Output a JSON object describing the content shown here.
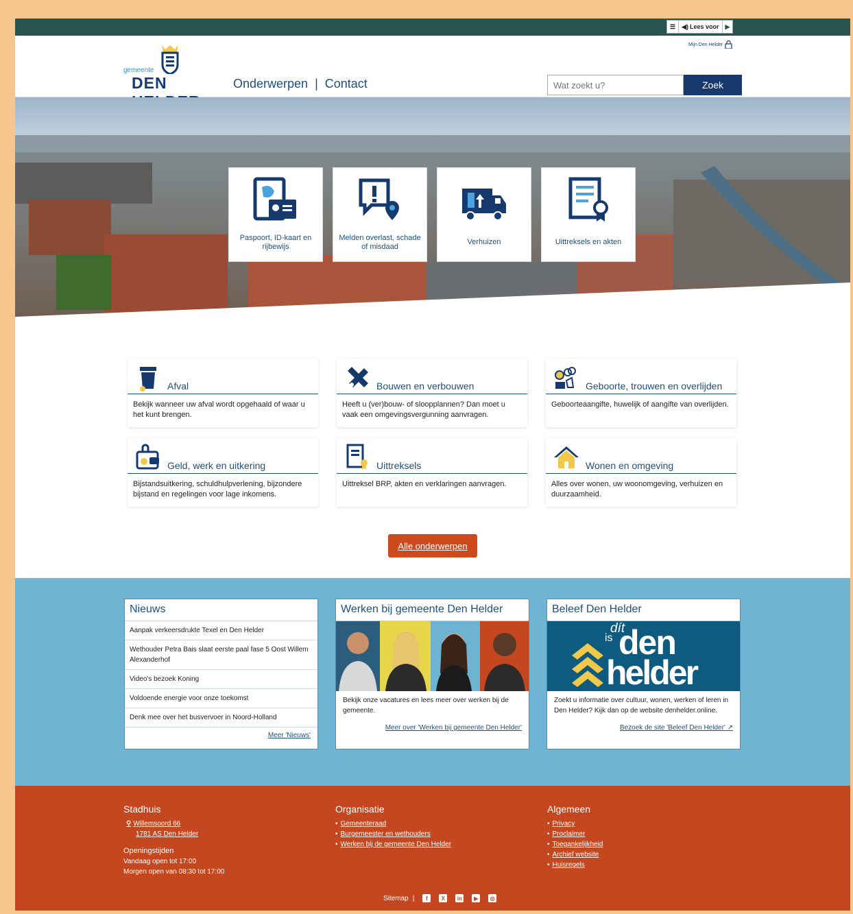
{
  "topbar": {
    "read_label": "Lees voor"
  },
  "header": {
    "mijn_label": "Mijn Den Helder",
    "logo_small": "gemeente",
    "logo_big": "DEN HELDER",
    "nav": [
      "Onderwerpen",
      "|",
      "Contact"
    ],
    "search_placeholder": "Wat zoekt u?",
    "search_button": "Zoek"
  },
  "hero": {
    "tiles": [
      {
        "label": "Paspoort, ID-kaart en rijbewijs",
        "icon": "id-card-icon"
      },
      {
        "label": "Melden overlast, schade of misdaad",
        "icon": "report-location-icon"
      },
      {
        "label": "Verhuizen",
        "icon": "moving-truck-icon"
      },
      {
        "label": "Uittreksels en akten",
        "icon": "certificate-icon"
      }
    ]
  },
  "topics": [
    {
      "title": "Afval",
      "text": "Bekijk wanneer uw afval wordt opgehaald of waar u het kunt brengen.",
      "icon": "bin-icon"
    },
    {
      "title": "Bouwen en verbouwen",
      "text": "Heeft u (ver)bouw- of sloopplannen? Dan moet u vaak een omgevingsvergunning aanvragen.",
      "icon": "tools-icon"
    },
    {
      "title": "Geboorte, trouwen en overlijden",
      "text": "Geboorteaangifte, huwelijk of aangifte van overlijden.",
      "icon": "family-icon"
    },
    {
      "title": "Geld, werk en uitkering",
      "text": "Bijstandsuitkering, schuldhulpverlening, bijzondere bijstand en regelingen voor lage inkomens.",
      "icon": "wallet-icon"
    },
    {
      "title": "Uittreksels",
      "text": "Uittreksel BRP, akten en verklaringen aanvragen.",
      "icon": "document-icon"
    },
    {
      "title": "Wonen en omgeving",
      "text": "Alles over wonen, uw woonomgeving, verhuizen en duurzaamheid.",
      "icon": "house-icon"
    }
  ],
  "alle_button": "Alle onderwerpen",
  "news": {
    "title": "Nieuws",
    "items": [
      "Aanpak verkeersdrukte Texel en Den Helder",
      "Wethouder Petra Bais slaat eerste paal fase 5 Oost Willem Alexanderhof",
      "Video's bezoek Koning",
      "Voldoende energie voor onze toekomst",
      "Denk mee over het busvervoer in Noord-Holland"
    ],
    "more": "Meer 'Nieuws'"
  },
  "werken": {
    "title": "Werken bij gemeente Den Helder",
    "text": "Bekijk onze vacatures en lees meer over werken bij de gemeente.",
    "link": "Meer over 'Werken bij gemeente Den Helder'"
  },
  "beleef": {
    "title": "Beleef Den Helder",
    "banner_top": "dít",
    "banner_is": "is",
    "banner_main1": "den",
    "banner_main2": "helder",
    "text": "Zoekt u informatie over cultuur, wonen, werken of leren in Den Helder? Kijk dan op de website denhelder.online.",
    "link": "Bezoek de site 'Beleef Den Helder'"
  },
  "footer": {
    "stadhuis": {
      "title": "Stadhuis",
      "address1": "Willemsoord 66",
      "address2": "1781 AS Den Helder",
      "hours_title": "Openingstijden",
      "today": "Vandaag open tot 17:00",
      "tomorrow": "Morgen open van 08:30 tot 17:00"
    },
    "organisatie": {
      "title": "Organisatie",
      "items": [
        "Gemeenteraad",
        "Burgemeester en wethouders",
        "Werken bij de gemeente Den Helder"
      ]
    },
    "algemeen": {
      "title": "Algemeen",
      "items": [
        "Privacy",
        "Proclaimer",
        "Toegankelijkheid",
        "Archief website",
        "Huisregels"
      ]
    },
    "sitemap": "Sitemap",
    "social": [
      "facebook-icon",
      "x-icon",
      "linkedin-icon",
      "youtube-icon",
      "instagram-icon"
    ]
  },
  "colors": {
    "topbar": "#28534f",
    "navy": "#163a6e",
    "blue_section": "#70b4d3",
    "footer": "#c4471f",
    "accent_button": "#cc4a1e"
  }
}
